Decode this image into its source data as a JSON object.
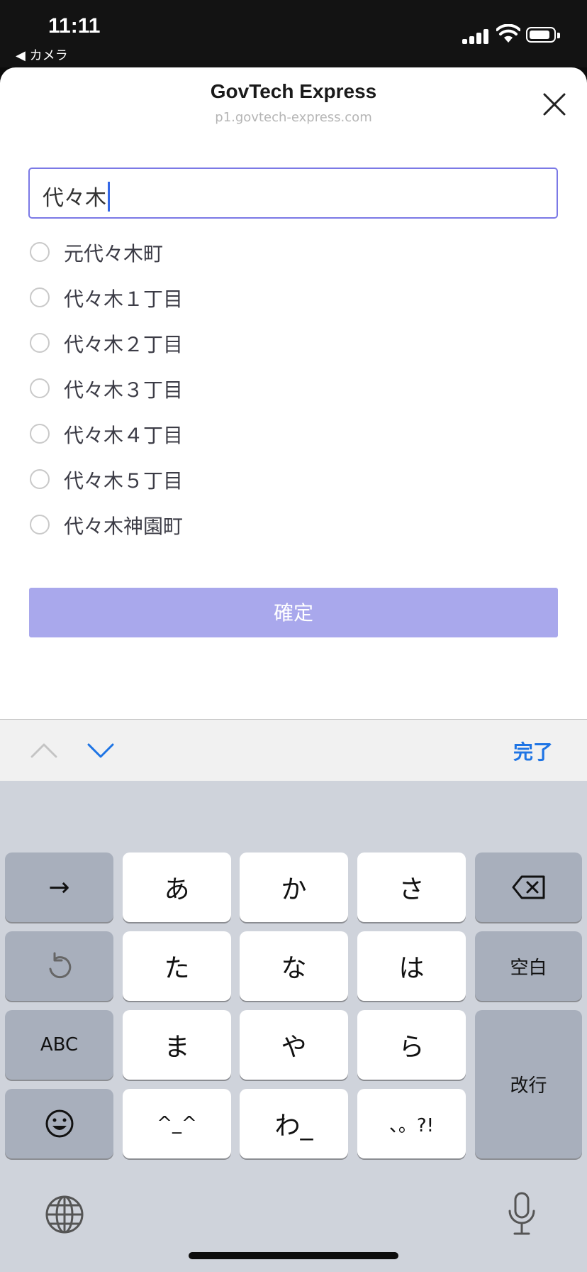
{
  "status_bar": {
    "time": "11:11",
    "back_label": "◀ カメラ"
  },
  "sheet": {
    "title": "GovTech Express",
    "url": "p1.govtech-express.com",
    "search_value": "代々木",
    "options": [
      "元代々木町",
      "代々木１丁目",
      "代々木２丁目",
      "代々木３丁目",
      "代々木４丁目",
      "代々木５丁目",
      "代々木神園町"
    ],
    "confirm_label": "確定"
  },
  "accessory": {
    "done_label": "完了"
  },
  "keyboard": {
    "row1": [
      "→",
      "あ",
      "か",
      "さ"
    ],
    "row2": [
      "た",
      "な",
      "は",
      "空白"
    ],
    "row3": [
      "ABC",
      "ま",
      "や",
      "ら",
      "改行"
    ],
    "row4": [
      "^_^",
      "わ_",
      "、。?!"
    ]
  }
}
